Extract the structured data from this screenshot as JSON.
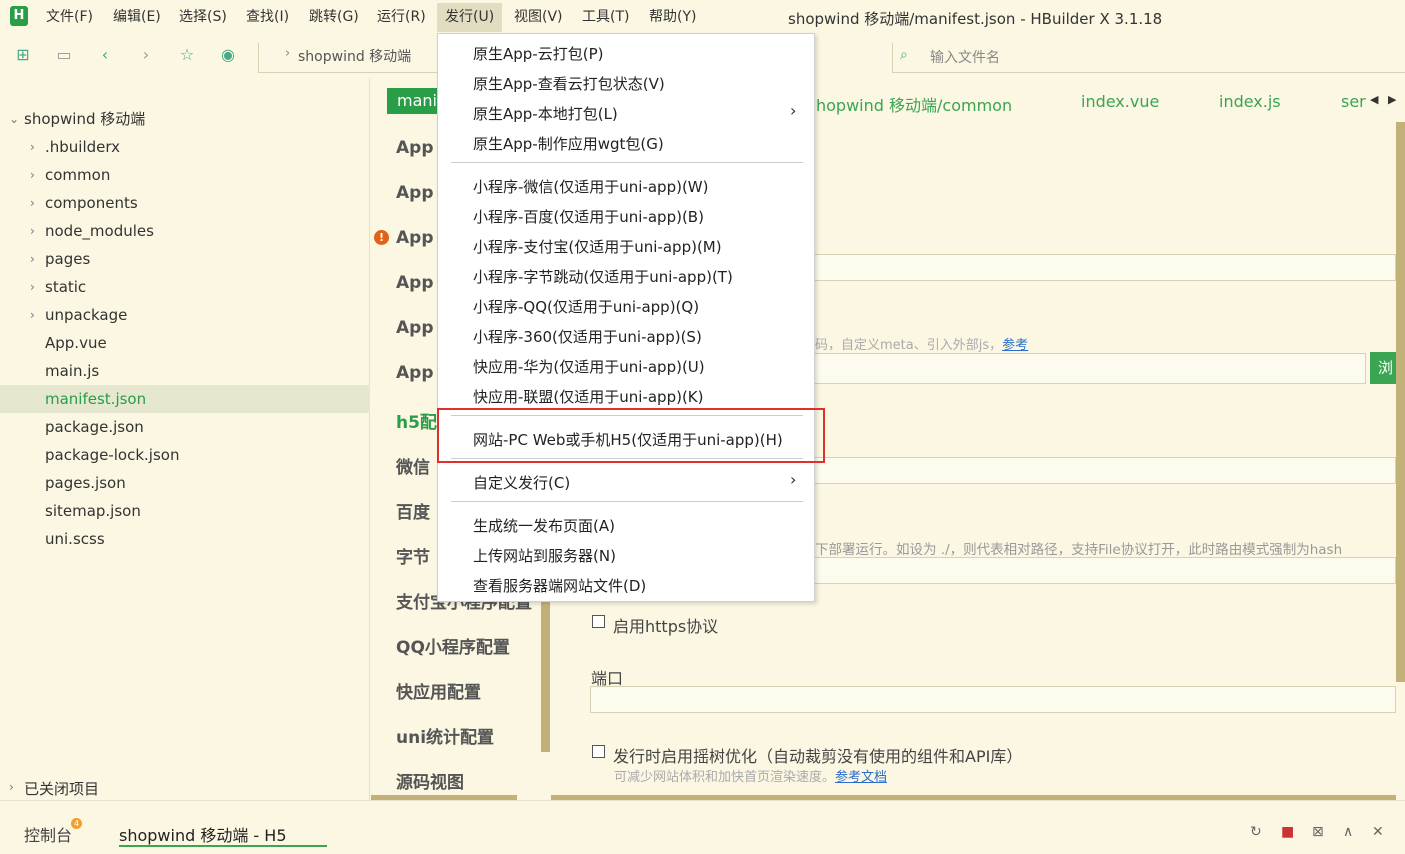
{
  "app": {
    "logo": "H",
    "window_title": "shopwind 移动端/manifest.json - HBuilder X 3.1.18"
  },
  "menubar": {
    "items": [
      "文件(F)",
      "编辑(E)",
      "选择(S)",
      "查找(I)",
      "跳转(G)",
      "运行(R)",
      "发行(U)",
      "视图(V)",
      "工具(T)",
      "帮助(Y)"
    ],
    "active": "发行(U)"
  },
  "toolbar": {
    "breadcrumb": "shopwind 移动端",
    "file_search_placeholder": "输入文件名"
  },
  "sidebar": {
    "root": "shopwind 移动端",
    "items": [
      ".hbuilderx",
      "common",
      "components",
      "node_modules",
      "pages",
      "static",
      "unpackage",
      "App.vue",
      "main.js",
      "manifest.json",
      "package.json",
      "package-lock.json",
      "pages.json",
      "sitemap.json",
      "uni.scss"
    ],
    "selected": "manifest.json",
    "closed_projects": "已关闭项目"
  },
  "tabs": {
    "active": "mani",
    "items": [
      "hopwind 移动端/common",
      "index.vue",
      "index.js",
      "ser"
    ]
  },
  "config_nav": {
    "items": [
      "App",
      "App",
      "App",
      "App",
      "App",
      "App",
      "h5配",
      "微信",
      "百度",
      "字节",
      "支付宝小程序配置",
      "QQ小程序配置",
      "快应用配置",
      "uni统计配置",
      "源码视图"
    ],
    "active": "h5配"
  },
  "publish_menu": {
    "items": [
      "原生App-云打包(P)",
      "原生App-查看云打包状态(V)",
      "原生App-本地打包(L)",
      "原生App-制作应用wgt包(G)",
      "小程序-微信(仅适用于uni-app)(W)",
      "小程序-百度(仅适用于uni-app)(B)",
      "小程序-支付宝(仅适用于uni-app)(M)",
      "小程序-字节跳动(仅适用于uni-app)(T)",
      "小程序-QQ(仅适用于uni-app)(Q)",
      "小程序-360(仅适用于uni-app)(S)",
      "快应用-华为(仅适用于uni-app)(U)",
      "快应用-联盟(仅适用于uni-app)(K)",
      "网站-PC Web或手机H5(仅适用于uni-app)(H)",
      "自定义发行(C)",
      "生成统一发布页面(A)",
      "上传网站到服务器(N)",
      "查看服务器端网站文件(D)"
    ],
    "highlighted": "网站-PC Web或手机H5(仅适用于uni-app)(H)"
  },
  "content": {
    "template_hint": "码，自定义meta、引入外部js，",
    "template_hint_link": "参考",
    "browse_button": "浏",
    "base_path_hint": "下部署运行。如设为 ./，则代表相对路径，支持File协议打开，此时路由模式强制为hash",
    "https_label": "启用https协议",
    "port_label": "端口",
    "treeshake_label": "发行时启用摇树优化（自动裁剪没有使用的组件和API库）",
    "treeshake_hint": "可减少网站体积和加快首页渲染速度。",
    "treeshake_hint_link": "参考文档"
  },
  "statusbar": {
    "console": "控制台",
    "console_badge": "4",
    "console_tab": "shopwind 移动端 - H5"
  },
  "colors": {
    "accent": "#2a9d47",
    "background": "#fbf7e3",
    "highlight_border": "#e0302d"
  }
}
